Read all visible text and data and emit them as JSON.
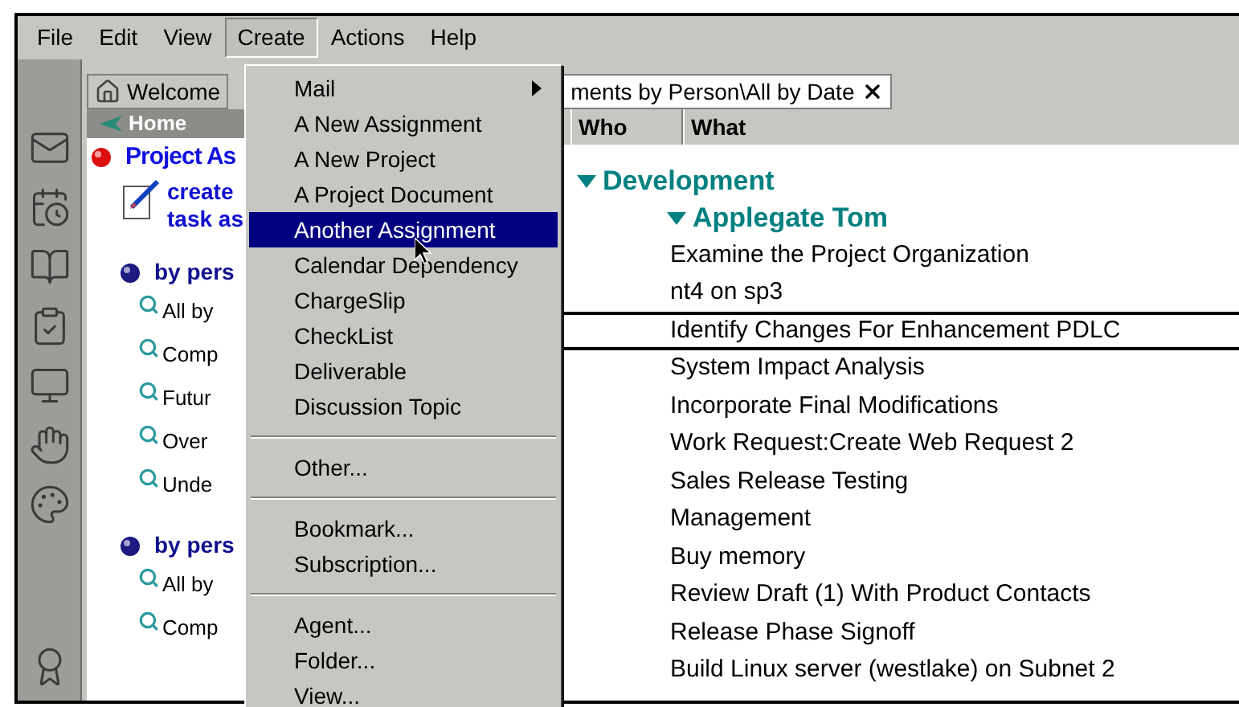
{
  "menu_bar": [
    {
      "label": "File",
      "selected": false
    },
    {
      "label": "Edit",
      "selected": false
    },
    {
      "label": "View",
      "selected": false
    },
    {
      "label": "Create",
      "selected": true
    },
    {
      "label": "Actions",
      "selected": false
    },
    {
      "label": "Help",
      "selected": false
    }
  ],
  "tabs": [
    {
      "label": "Welcome",
      "selected": false,
      "closable": false
    },
    {
      "label": "ments by Person\\All by Date",
      "selected": true,
      "closable": true
    }
  ],
  "home_panel": {
    "title": "Home",
    "heading": "Project As",
    "create_lines": [
      "create",
      "task as"
    ],
    "sections": [
      {
        "label": "by pers",
        "views": [
          "All by",
          "Comp",
          "Futur",
          "Over",
          "Unde"
        ]
      },
      {
        "label": "by pers",
        "views": [
          "All by",
          "Comp"
        ]
      }
    ]
  },
  "view": {
    "columns": [
      "Who",
      "What"
    ],
    "groups": [
      {
        "label": "Development",
        "expanded": true,
        "children": [
          {
            "label": "Applegate Tom",
            "expanded": true,
            "rows": [
              {
                "what": "Examine the Project Organization",
                "selected": false
              },
              {
                "what": "nt4 on sp3",
                "selected": false
              },
              {
                "what": "Identify Changes For Enhancement PDLC",
                "selected": true
              },
              {
                "what": "System Impact Analysis",
                "selected": false
              },
              {
                "what": "Incorporate Final Modifications",
                "selected": false
              },
              {
                "what": "Work Request:Create Web Request 2",
                "selected": false
              },
              {
                "what": "Sales Release Testing",
                "selected": false
              },
              {
                "what": "Management",
                "selected": false
              },
              {
                "what": "Buy memory",
                "selected": false
              },
              {
                "what": "Review Draft (1) With Product Contacts",
                "selected": false
              },
              {
                "what": "Release Phase Signoff",
                "selected": false
              },
              {
                "what": "Build Linux server (westlake) on Subnet 2",
                "selected": false
              }
            ]
          }
        ]
      }
    ]
  },
  "create_menu": [
    {
      "kind": "item",
      "label": "Mail",
      "submenu": true,
      "selected": false
    },
    {
      "kind": "item",
      "label": "A New Assignment",
      "submenu": false,
      "selected": false
    },
    {
      "kind": "item",
      "label": "A New Project",
      "submenu": false,
      "selected": false
    },
    {
      "kind": "item",
      "label": "A Project Document",
      "submenu": false,
      "selected": false
    },
    {
      "kind": "item",
      "label": "Another Assignment",
      "submenu": false,
      "selected": true
    },
    {
      "kind": "item",
      "label": "Calendar Dependency",
      "submenu": false,
      "selected": false
    },
    {
      "kind": "item",
      "label": "ChargeSlip",
      "submenu": false,
      "selected": false
    },
    {
      "kind": "item",
      "label": "CheckList",
      "submenu": false,
      "selected": false
    },
    {
      "kind": "item",
      "label": "Deliverable",
      "submenu": false,
      "selected": false
    },
    {
      "kind": "item",
      "label": "Discussion Topic",
      "submenu": false,
      "selected": false
    },
    {
      "kind": "separator"
    },
    {
      "kind": "item",
      "label": "Other...",
      "submenu": false,
      "selected": false
    },
    {
      "kind": "separator"
    },
    {
      "kind": "item",
      "label": "Bookmark...",
      "submenu": false,
      "selected": false
    },
    {
      "kind": "item",
      "label": "Subscription...",
      "submenu": false,
      "selected": false
    },
    {
      "kind": "separator"
    },
    {
      "kind": "item",
      "label": "Agent...",
      "submenu": false,
      "selected": false
    },
    {
      "kind": "item",
      "label": "Folder...",
      "submenu": false,
      "selected": false
    },
    {
      "kind": "item",
      "label": "View...",
      "submenu": false,
      "selected": false
    }
  ]
}
